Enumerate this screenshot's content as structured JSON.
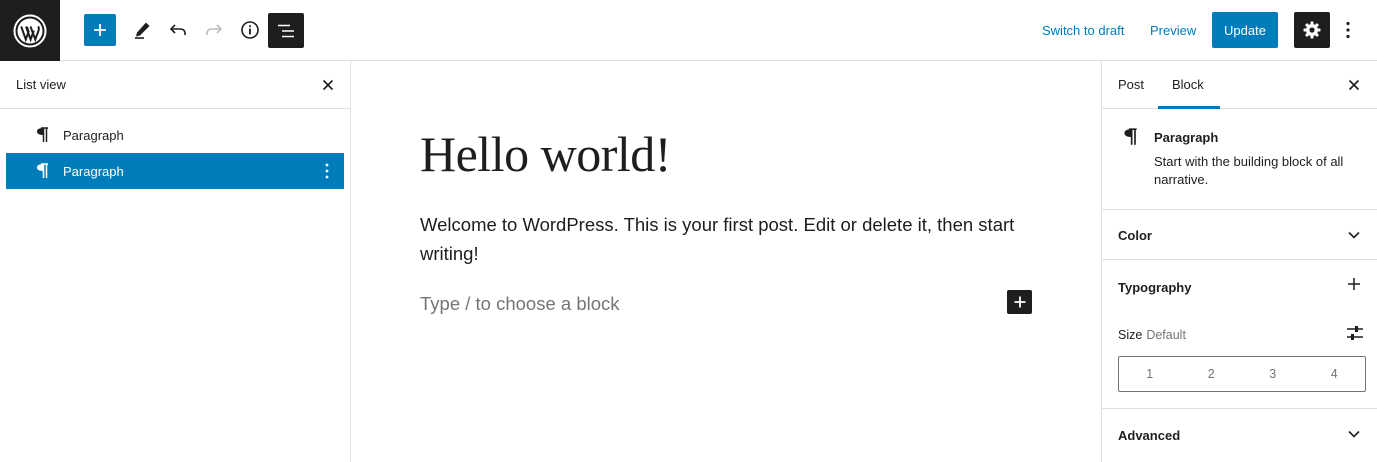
{
  "toolbar": {
    "logo_icon": "wordpress-icon",
    "add_icon": "plus-icon",
    "edit_icon": "pencil-icon",
    "undo_icon": "undo-icon",
    "redo_icon": "redo-icon",
    "info_icon": "info-icon",
    "list_view_icon": "list-view-icon",
    "switch_to_draft": "Switch to draft",
    "preview": "Preview",
    "update": "Update",
    "settings_icon": "gear-icon",
    "more_icon": "more-vertical-icon"
  },
  "list_view": {
    "title": "List view",
    "items": [
      {
        "label": "Paragraph",
        "selected": false
      },
      {
        "label": "Paragraph",
        "selected": true
      }
    ]
  },
  "editor": {
    "title": "Hello world!",
    "body": "Welcome to WordPress. This is your first post. Edit or delete it, then start writing!",
    "placeholder": "Type / to choose a block"
  },
  "sidebar": {
    "tabs": [
      {
        "label": "Post",
        "active": false
      },
      {
        "label": "Block",
        "active": true
      }
    ],
    "block": {
      "name": "Paragraph",
      "description": "Start with the building block of all narrative."
    },
    "panels": {
      "color": "Color",
      "typography": "Typography",
      "advanced": "Advanced"
    },
    "size": {
      "label": "Size",
      "value": "Default",
      "options": [
        "1",
        "2",
        "3",
        "4"
      ]
    }
  },
  "colors": {
    "accent": "#007cba",
    "dark": "#1e1e1e",
    "border": "#e0e0e0",
    "muted": "#757575"
  }
}
